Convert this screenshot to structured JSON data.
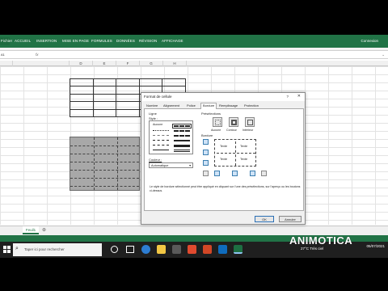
{
  "ribbon": {
    "tabs": [
      "Fichier",
      "ACCUEIL",
      "INSERTION",
      "MISE EN PAGE",
      "FORMULES",
      "DONNÉES",
      "RÉVISION",
      "AFFICHAGE"
    ],
    "signin": "Connexion"
  },
  "formula_bar": {
    "namebox": "A1",
    "fx": "fx"
  },
  "columns": [
    "D",
    "E",
    "F",
    "G",
    "H"
  ],
  "sheet": {
    "tab": "Feuil1"
  },
  "dialog": {
    "title": "Format de cellule",
    "help": "?",
    "close": "✕",
    "tabs": [
      "Nombre",
      "Alignement",
      "Police",
      "Bordure",
      "Remplissage",
      "Protection"
    ],
    "line_label": "Ligne",
    "style_label": "Style :",
    "none_label": "Aucune",
    "color_label": "Couleur :",
    "color_value": "Automatique",
    "presets_label": "Présélections",
    "presets": [
      "Aucune",
      "Contour",
      "Intérieur"
    ],
    "border_label": "Bordure",
    "preview_text": [
      "Texte",
      "Texte",
      "Texte",
      "Texte"
    ],
    "description": "Le style de bordure sélectionné peut être appliqué en cliquant sur l'une des présélections, sur l'aperçu ou les boutons ci-dessus.",
    "ok": "OK",
    "cancel": "Annuler"
  },
  "taskbar": {
    "search_placeholder": "Taper ici pour rechercher",
    "weather": "27°C  Très ciel",
    "time": "",
    "date": "05/07/2021"
  },
  "watermark": "ANIMOTICA"
}
